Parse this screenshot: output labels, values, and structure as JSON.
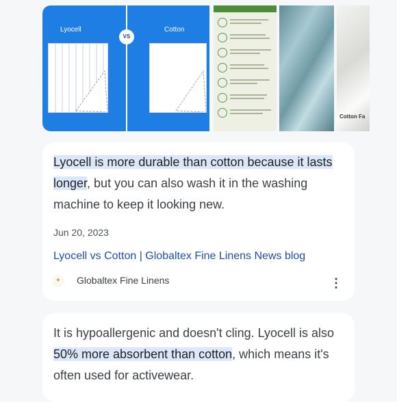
{
  "images": {
    "compare": {
      "left_label": "Lyocell",
      "vs_label": "VS",
      "right_label": "Cotton"
    },
    "third_caption": "Cotton Fa"
  },
  "results": [
    {
      "snippet_highlight": "Lyocell is more durable than cotton because it lasts longer",
      "snippet_rest": ", but you can also wash it in the washing machine to keep it looking new.",
      "date": "Jun 20, 2023",
      "title": "Lyocell vs Cotton | Globaltex Fine Linens News blog",
      "source": "Globaltex Fine Linens"
    },
    {
      "snippet_before": "It is hypoallergenic and doesn't cling. Lyocell is also ",
      "snippet_highlight": "50% more absorbent than cotton",
      "snippet_after": ", which means it's often used for activewear."
    }
  ],
  "colors": {
    "accent_blue": "#1e7ee3",
    "link": "#1a4fa8",
    "highlight": "#dbe7fb"
  },
  "icons": {
    "more": "more-vert-icon",
    "favicon": "site-favicon-icon"
  }
}
